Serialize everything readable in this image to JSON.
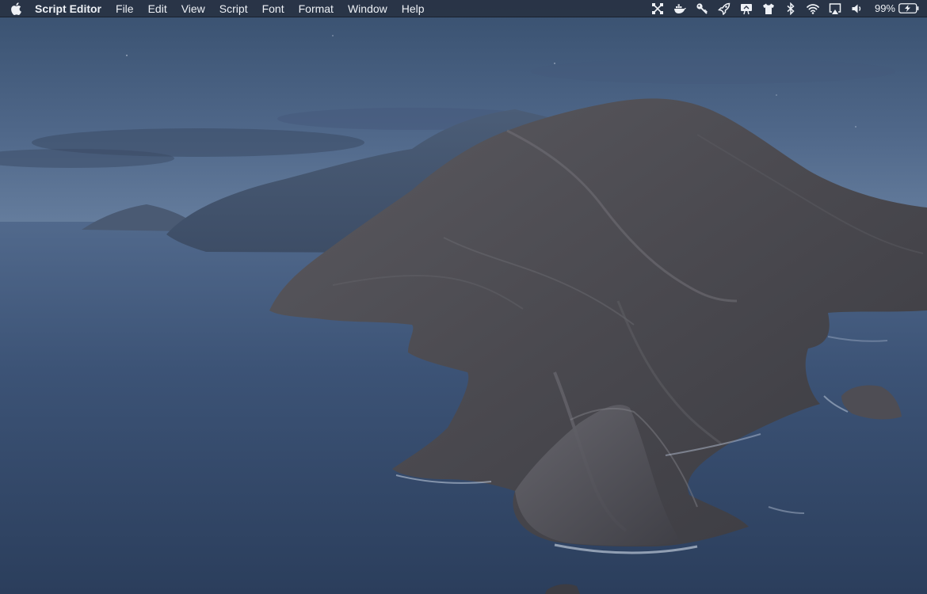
{
  "menubar": {
    "apple_icon": "apple-logo-icon",
    "app_name": "Script Editor",
    "menus": [
      "File",
      "Edit",
      "View",
      "Script",
      "Font",
      "Format",
      "Window",
      "Help"
    ],
    "status_icons": [
      "network-graph-icon",
      "docker-whale-icon",
      "key-icon",
      "rocket-icon",
      "screen-share-icon",
      "tshirt-icon",
      "bluetooth-icon",
      "wifi-icon",
      "airplay-icon",
      "volume-icon"
    ],
    "battery_percent": "99%",
    "battery_state": "charging"
  },
  "colors": {
    "menubar_bg": "#262e3e",
    "menubar_text": "#eef1f6",
    "sky_top": "#3c5274",
    "sky_horizon": "#5e7596",
    "ocean": "#34496a",
    "rock": "#4d4c52"
  }
}
